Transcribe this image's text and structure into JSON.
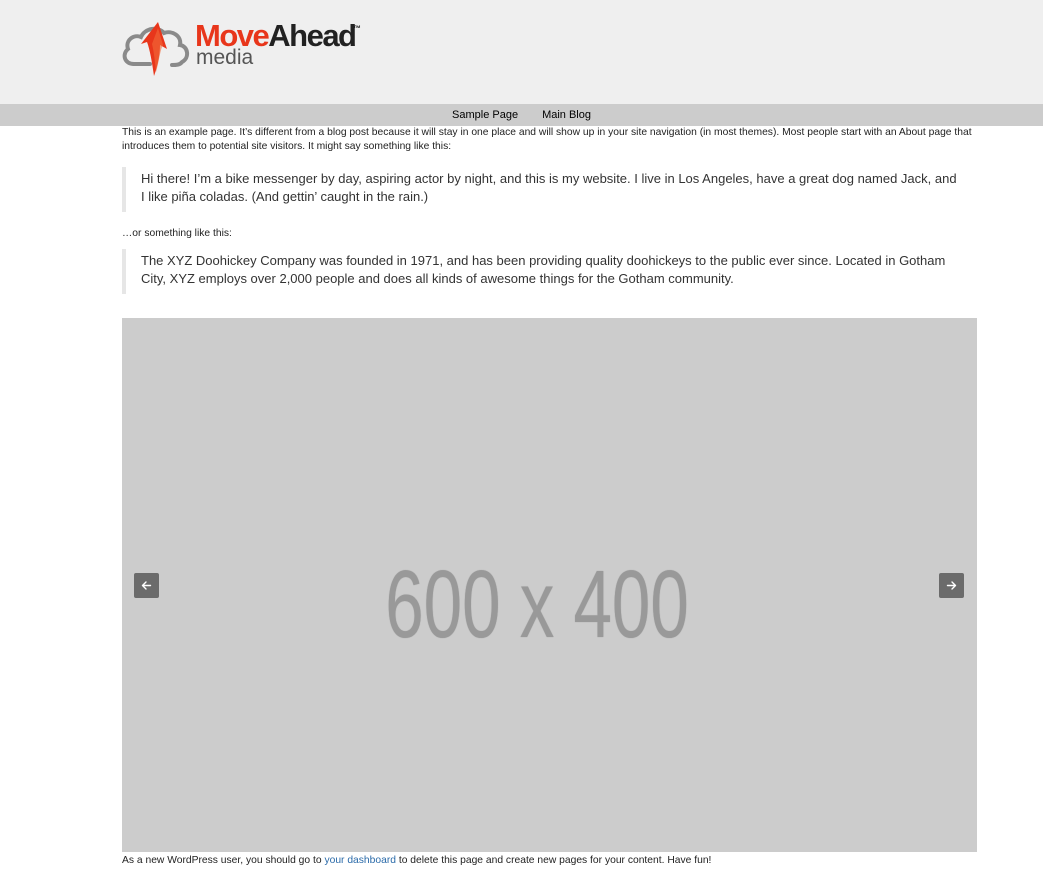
{
  "brand": {
    "name_part1": "Move",
    "name_part2": "Ahead",
    "trademark": "™",
    "subtitle": "media",
    "colors": {
      "accent": "#e8361b",
      "dark": "#222222",
      "cloud": "#777777"
    }
  },
  "nav": {
    "items": [
      {
        "label": "Sample Page"
      },
      {
        "label": "Main Blog"
      }
    ]
  },
  "content": {
    "intro": "This is an example page. It’s different from a blog post because it will stay in one place and will show up in your site navigation (in most themes). Most people start with an About page that introduces them to potential site visitors. It might say something like this:",
    "quote1": "Hi there! I’m a bike messenger by day, aspiring actor by night, and this is my website. I live in Los Angeles, have a great dog named Jack, and I like piña coladas. (And gettin’ caught in the rain.)",
    "or_line": "…or something like this:",
    "quote2": "The XYZ Doohickey Company was founded in 1971, and has been providing quality doohickeys to the public ever since. Located in Gotham City, XYZ employs over 2,000 people and does all kinds of awesome things for the Gotham community.",
    "slider": {
      "placeholder_text": "600 x 400",
      "prev_icon": "arrow-left-icon",
      "next_icon": "arrow-right-icon"
    },
    "footer": {
      "before_link": "As a new WordPress user, you should go to ",
      "link_text": "your dashboard",
      "after_link": " to delete this page and create new pages for your content. Have fun!"
    }
  }
}
